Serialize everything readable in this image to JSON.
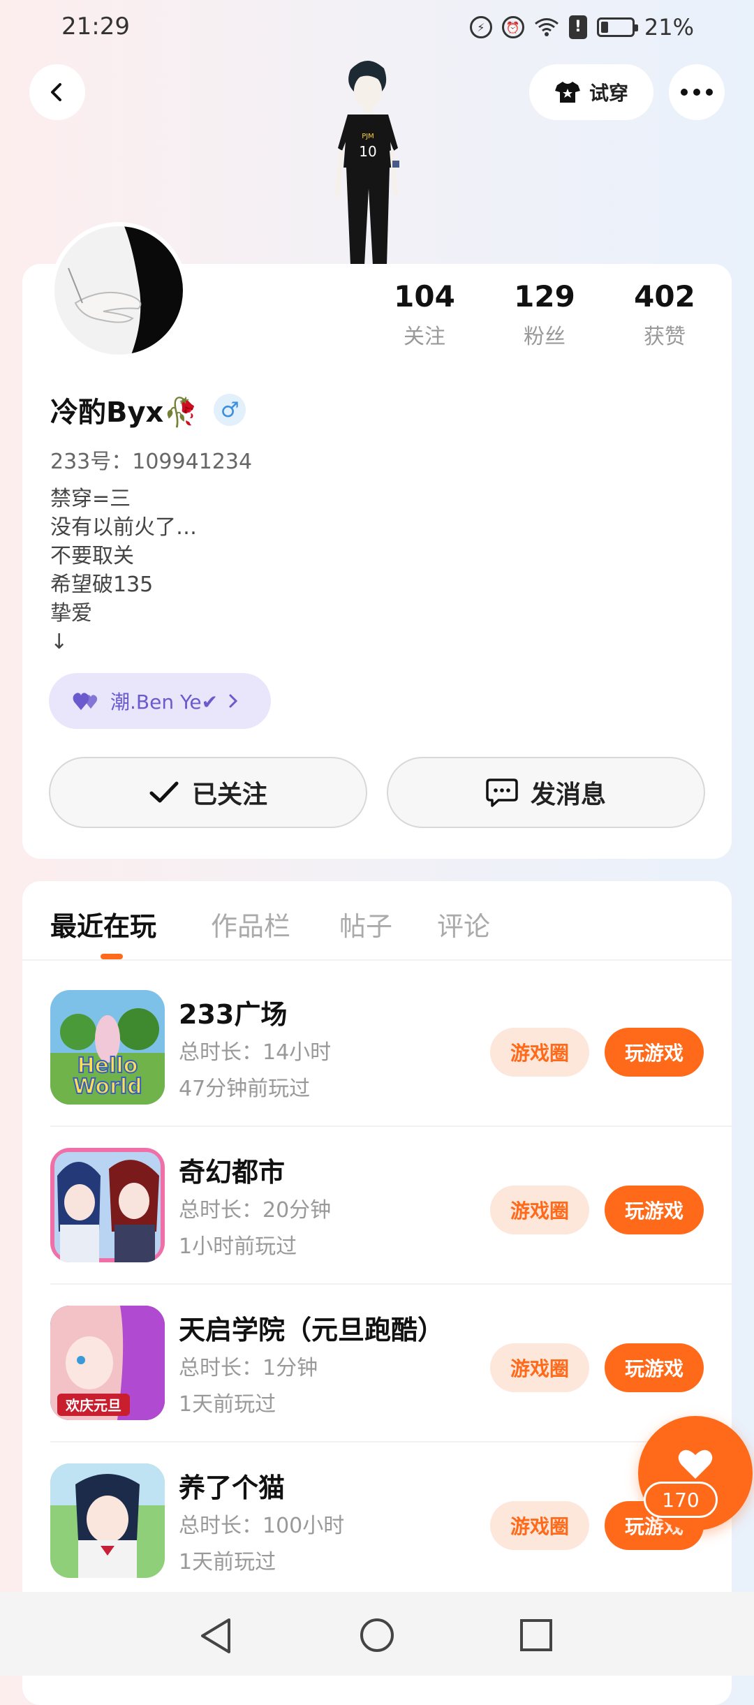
{
  "status_bar": {
    "time": "21:29",
    "battery": "21%"
  },
  "header": {
    "try_on_label": "试穿"
  },
  "stats": [
    {
      "value": "104",
      "label": "关注"
    },
    {
      "value": "129",
      "label": "粉丝"
    },
    {
      "value": "402",
      "label": "获赞"
    }
  ],
  "profile": {
    "username": "冷酌Byx🥀",
    "gender_symbol": "♂",
    "id_text": "233号：109941234",
    "bio": [
      "禁穿=三",
      "没有以前火了…",
      "不要取关",
      "希望破135",
      "挚爱",
      "↓"
    ],
    "friend_chip": "潮.Ben Ye✔"
  },
  "actions": {
    "follow_label": "已关注",
    "message_label": "发消息"
  },
  "tabs": [
    {
      "label": "最近在玩"
    },
    {
      "label": "作品栏"
    },
    {
      "label": "帖子"
    },
    {
      "label": "评论"
    }
  ],
  "games": [
    {
      "name": "233广场",
      "duration": "总时长：14小时",
      "last_played": "47分钟前玩过",
      "circle_label": "游戏圈",
      "play_label": "玩游戏",
      "thumb_text": "Hello World"
    },
    {
      "name": "奇幻都市",
      "duration": "总时长：20分钟",
      "last_played": "1小时前玩过",
      "circle_label": "游戏圈",
      "play_label": "玩游戏"
    },
    {
      "name": "天启学院（元旦跑酷）",
      "duration": "总时长：1分钟",
      "last_played": "1天前玩过",
      "circle_label": "游戏圈",
      "play_label": "玩游戏",
      "thumb_text": "欢庆元旦"
    },
    {
      "name": "养了个猫",
      "duration": "总时长：100小时",
      "last_played": "1天前玩过",
      "circle_label": "游戏圈",
      "play_label": "玩游戏"
    }
  ],
  "like": {
    "count": "170"
  },
  "colors": {
    "accent": "#ff6a1a",
    "accent_soft": "#fde6da",
    "chip_purple": "#e9e6fb"
  },
  "character_shirt_number": "10"
}
